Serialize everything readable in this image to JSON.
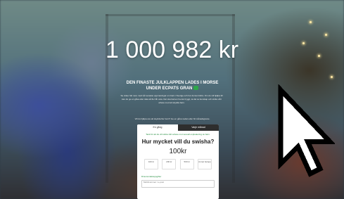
{
  "counter": {
    "amount": "1 000 982 kr"
  },
  "headline": {
    "line1": "DEN FINASTE JULKLAPPEN LADES I MORSE",
    "line2": "UNDER ECPATS GRAN"
  },
  "body_text": "Se video här nere med vår senaste uppmaningar om barn i Sverige och hur du kan bidra. Om du vill hjälpa till kan du ge en gåva eller dela så fler får veta. Det ska barnen ha det tryggt, ta del av kunskap och stötta vårt arbete med att skydda barn.",
  "small_note": "Vill du hjälpa oss att skydda fler barn? Ge en gåva nedan eller bli månadsgivare.",
  "card": {
    "tabs": [
      "En gång",
      "Varje månad"
    ],
    "info": "Tack för att du vill stötta vårt arbete mot sexuell exploatering av barn.",
    "question": "Hur mycket vill du swisha?",
    "amount": "100kr",
    "options": [
      "100 kr",
      "200 kr",
      "500 kr",
      "Annat belopp"
    ],
    "section_label": "Dina kontaktuppgifter",
    "input_placeholder": "Mobilnummer / e-post"
  },
  "colors": {
    "accent_green": "#2ea84a",
    "text_on_bg": "#ffffff"
  },
  "icons": {
    "cursor": "arrow-cursor-icon",
    "heart": "heart-icon"
  }
}
